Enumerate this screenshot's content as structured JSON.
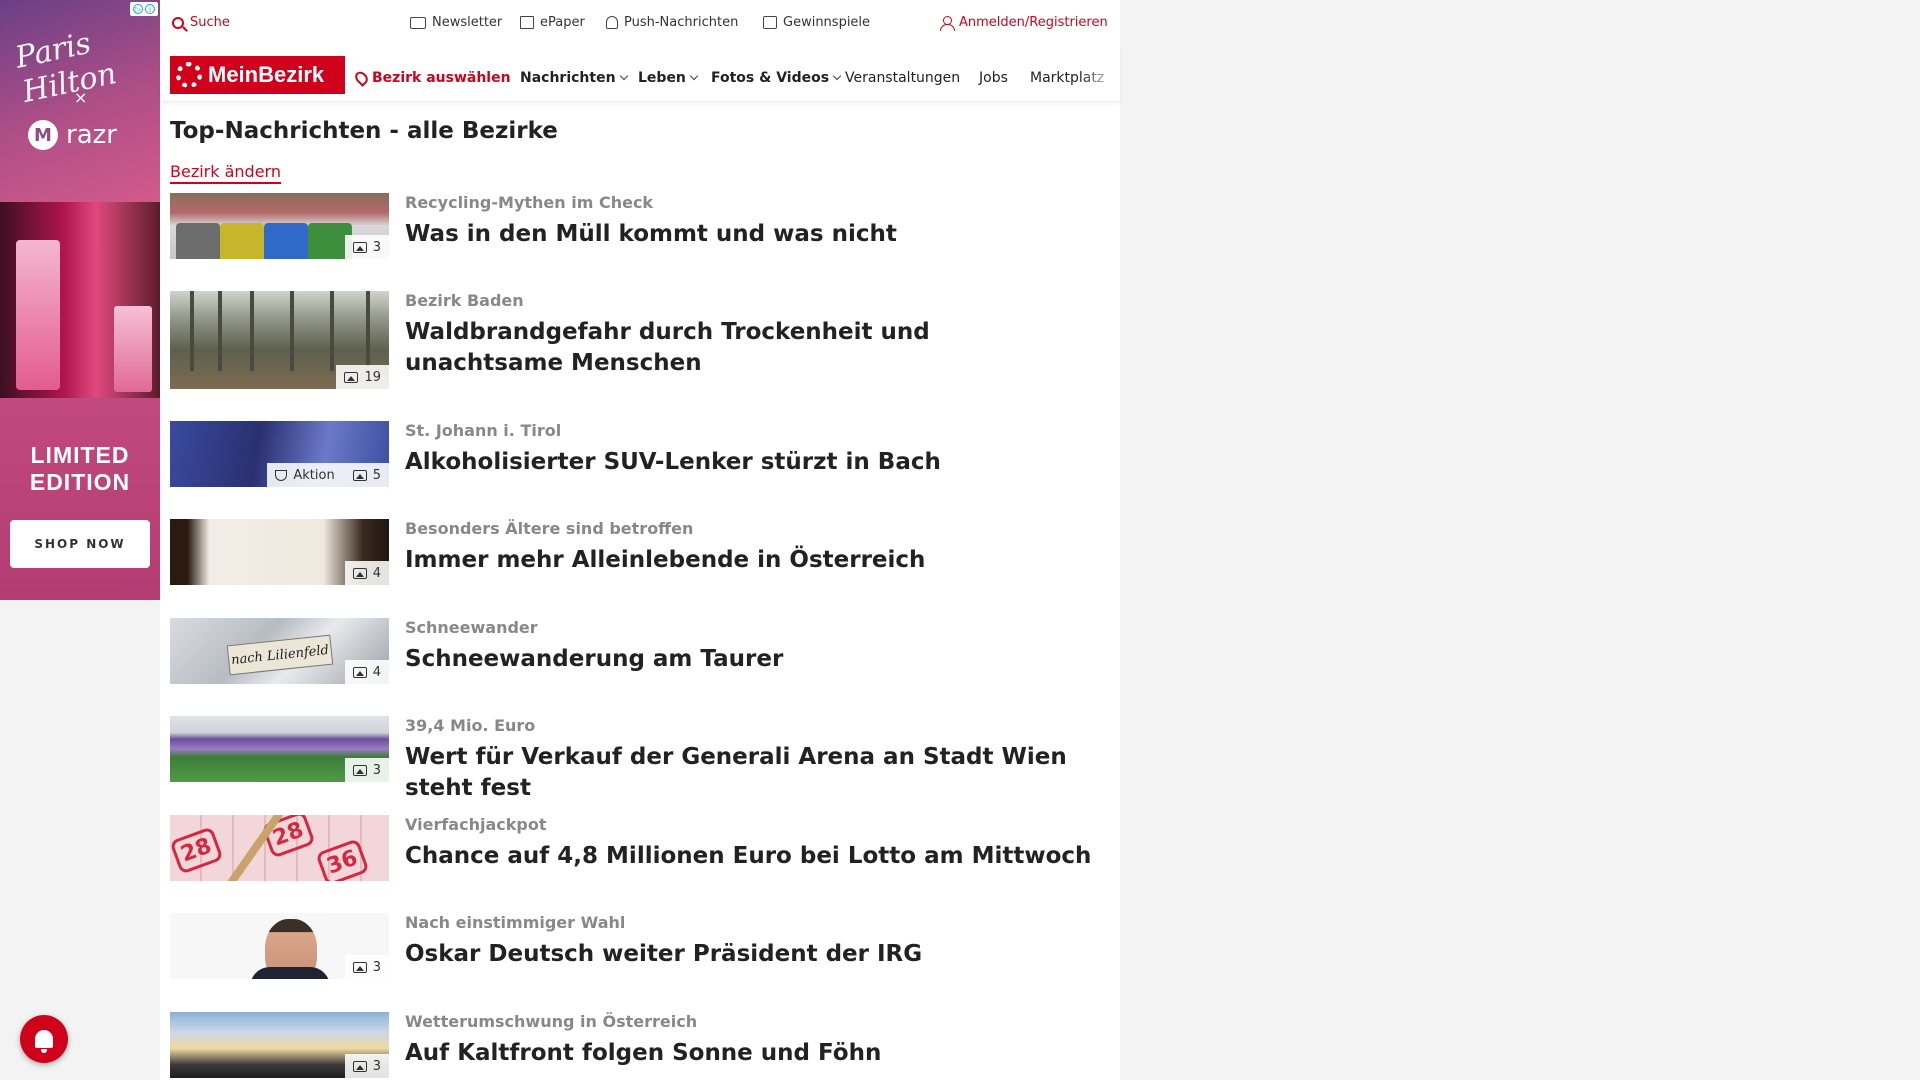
{
  "ad": {
    "signature": "Paris Hilton",
    "x": "×",
    "brand": "razr",
    "limited": "LIMITED EDITION",
    "cta": "SHOP NOW"
  },
  "topbar": {
    "search": "Suche",
    "newsletter": "Newsletter",
    "epaper": "ePaper",
    "push": "Push-Nachrichten",
    "gewinnspiele": "Gewinnspiele",
    "login": "Anmelden/Registrieren"
  },
  "nav": {
    "logo": "MeinBezirk",
    "bezirk": "Bezirk auswählen",
    "nachrichten": "Nachrichten",
    "leben": "Leben",
    "fotos": "Fotos & Videos",
    "veranstaltungen": "Veranstaltungen",
    "jobs": "Jobs",
    "marktplatz": "Marktplatz"
  },
  "section": {
    "title": "Top-Nachrichten - alle Bezirke",
    "change": "Bezirk ändern"
  },
  "articles": [
    {
      "kicker": "Recycling-Mythen im Check",
      "headline": "Was in den Müll kommt und was nicht",
      "count": "3"
    },
    {
      "kicker": "Bezirk Baden",
      "headline": "Waldbrandgefahr durch Trockenheit und unachtsame Menschen",
      "count": "19"
    },
    {
      "kicker": "St. Johann i. Tirol",
      "headline": "Alkoholisierter SUV-Lenker stürzt in Bach",
      "count": "5",
      "aktion": "Aktion"
    },
    {
      "kicker": "Besonders Ältere sind betroffen",
      "headline": "Immer mehr Alleinlebende in Österreich",
      "count": "4"
    },
    {
      "kicker": "Schneewander",
      "headline": "Schneewanderung am Taurer",
      "count": "4",
      "sign": "nach Lilienfeld"
    },
    {
      "kicker": "39,4 Mio. Euro",
      "headline": "Wert für Verkauf der Generali Arena an Stadt Wien steht fest",
      "count": "3"
    },
    {
      "kicker": "Vierfachjackpot",
      "headline": "Chance auf 4,8 Millionen Euro bei Lotto am Mittwoch",
      "numbers": [
        "28",
        "28",
        "36"
      ]
    },
    {
      "kicker": "Nach einstimmiger Wahl",
      "headline": "Oskar Deutsch weiter Präsident der IRG",
      "count": "3"
    },
    {
      "kicker": "Wetterumschwung in Österreich",
      "headline": "Auf Kaltfront folgen Sonne und Föhn",
      "count": "3"
    }
  ]
}
